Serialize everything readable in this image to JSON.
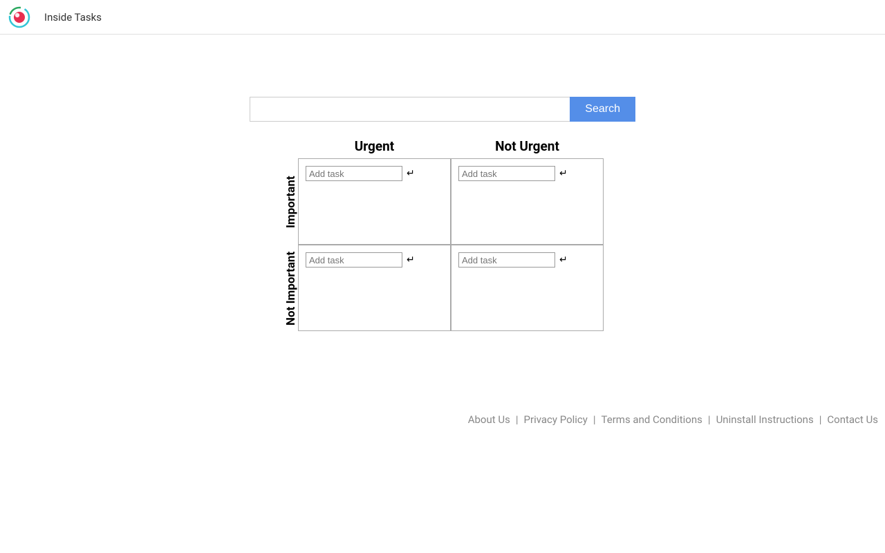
{
  "header": {
    "title": "Inside Tasks"
  },
  "search": {
    "button_label": "Search",
    "value": ""
  },
  "matrix": {
    "columns": [
      "Urgent",
      "Not Urgent"
    ],
    "rows": [
      "Important",
      "Not Important"
    ],
    "add_task_placeholder": "Add task",
    "enter_glyph": "↵"
  },
  "footer": {
    "links": [
      "About Us",
      "Privacy Policy",
      "Terms and Conditions",
      "Uninstall Instructions",
      "Contact Us"
    ],
    "separator": "|"
  },
  "colors": {
    "search_button": "#548ee8"
  }
}
